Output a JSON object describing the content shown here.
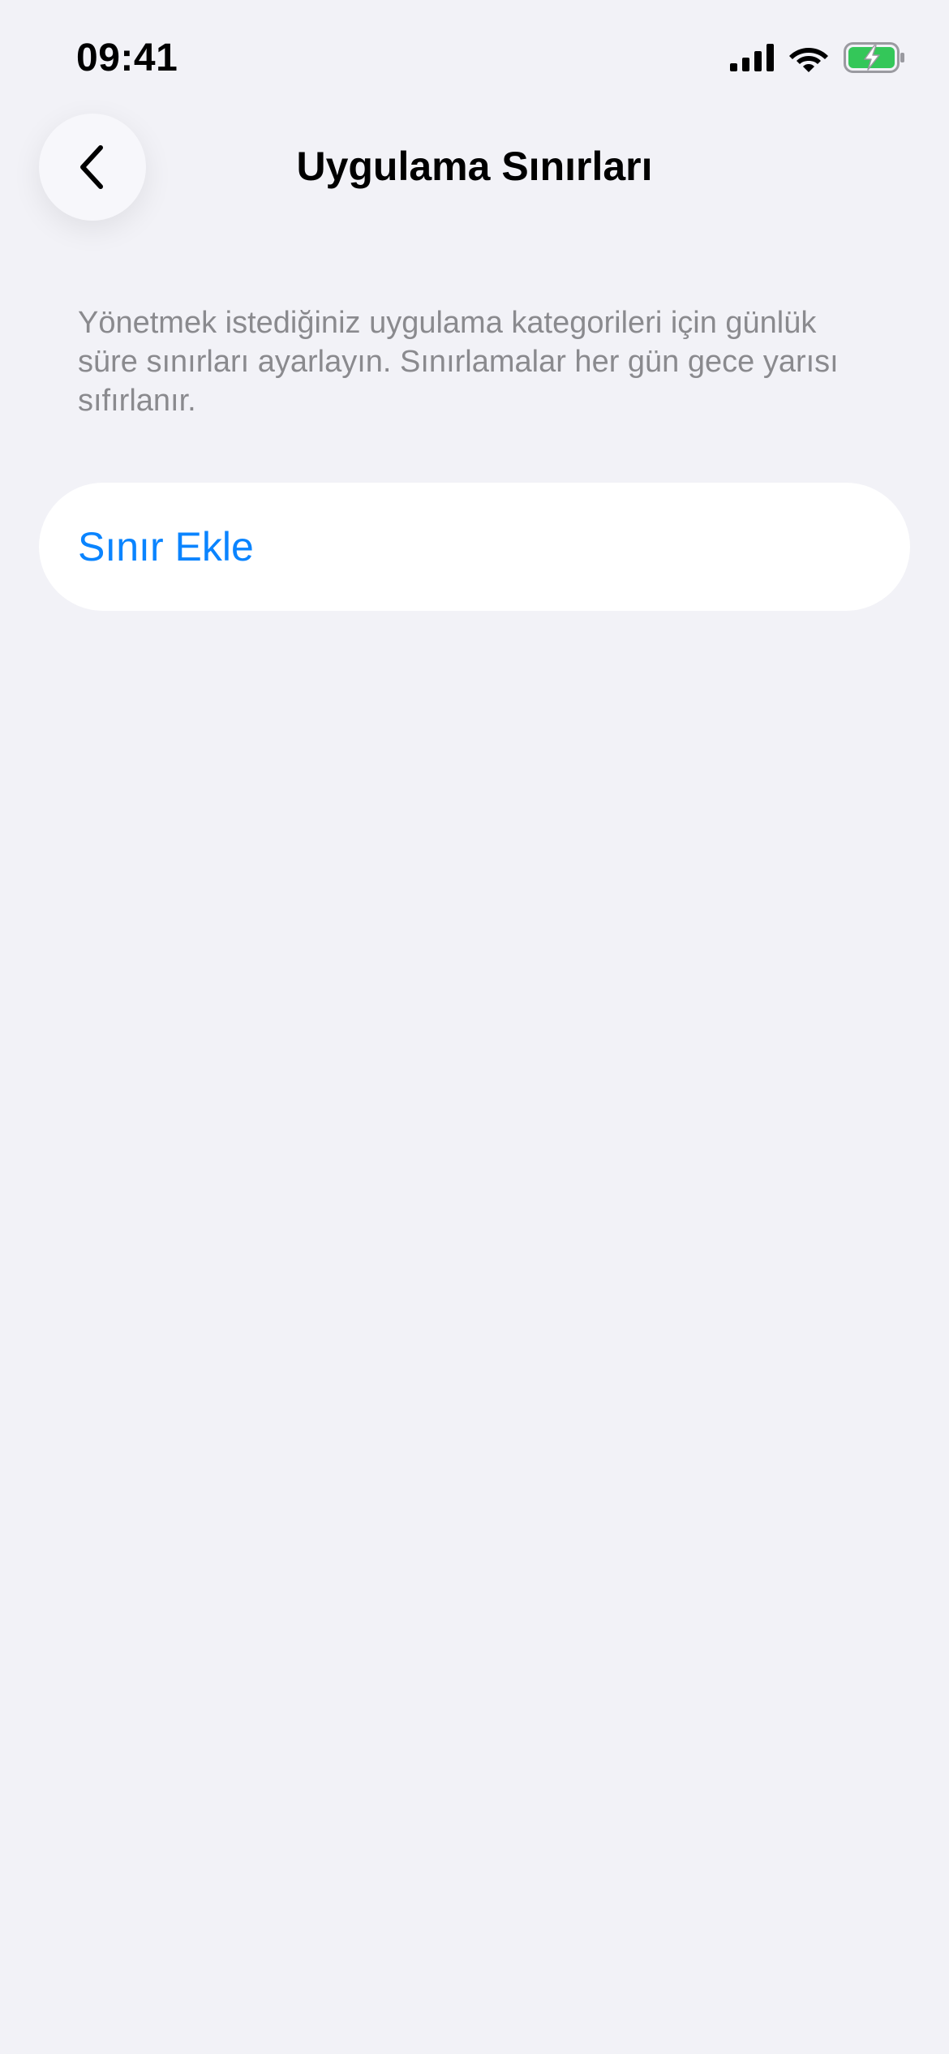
{
  "status_bar": {
    "time": "09:41",
    "battery_color": "#34c759"
  },
  "nav": {
    "back_icon": "chevron-left-icon",
    "title": "Uygulama Sınırları"
  },
  "description": "Yönetmek istediğiniz uygulama kategorileri için günlük süre sınırları ayarlayın. Sınırlamalar her gün gece yarısı sıfırlanır.",
  "actions": {
    "add_limit_label": "Sınır Ekle",
    "accent_color": "#0a84ff"
  }
}
